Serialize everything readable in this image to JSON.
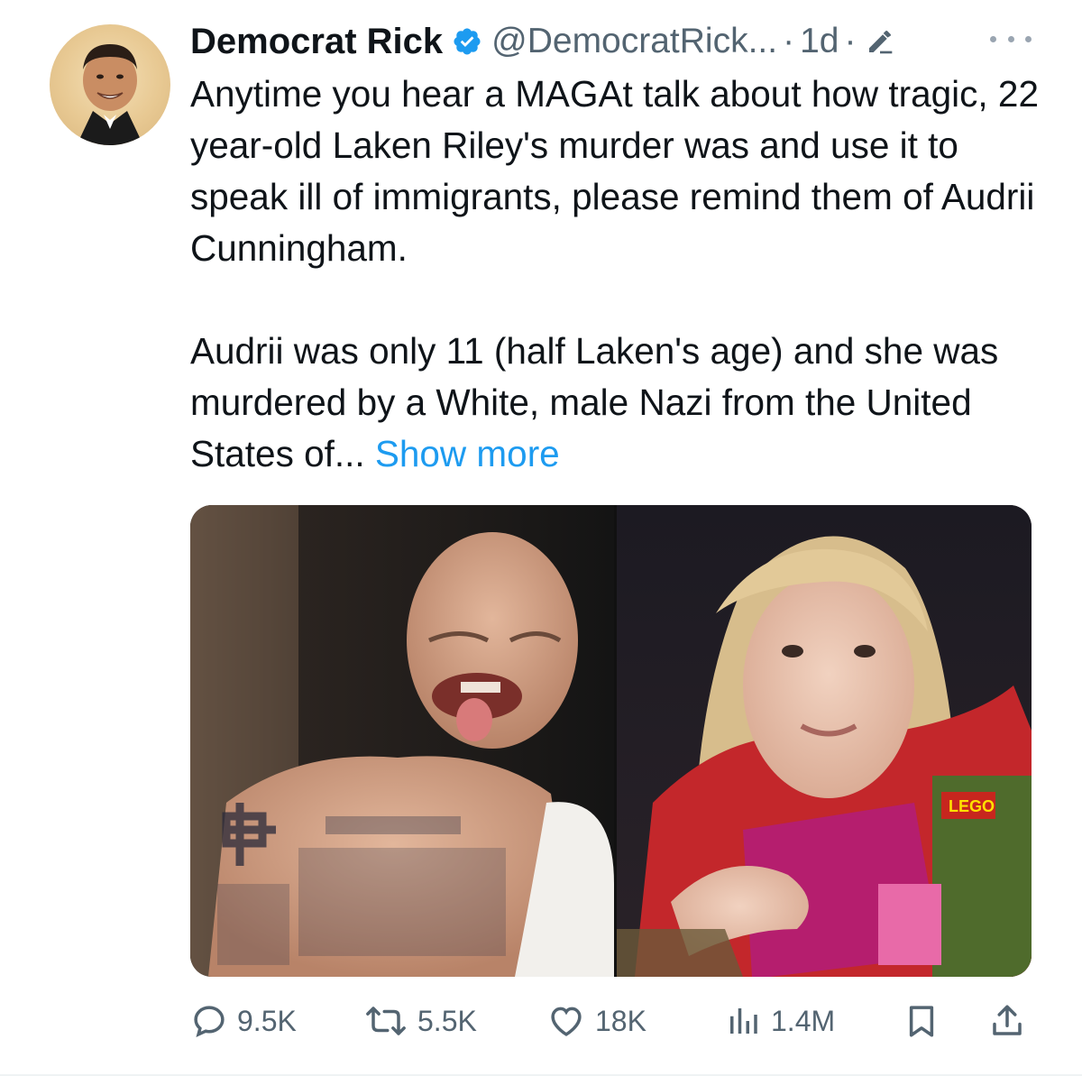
{
  "post": {
    "author_name": "Democrat Rick",
    "author_handle": "@DemocratRick...",
    "separator": "·",
    "age": "1d",
    "paragraph_1": "Anytime you hear a MAGAt talk about how tragic, 22 year-old Laken Riley's murder was and use it to speak ill of immigrants, please remind them of Audrii Cunningham.",
    "paragraph_2": "Audrii was only 11 (half Laken's age) and she was murdered by a White, male Nazi from the United States of...",
    "show_more": "Show more",
    "media_badge_text": "LEGO"
  },
  "actions": {
    "replies": "9.5K",
    "reposts": "5.5K",
    "likes": "18K",
    "views": "1.4M"
  },
  "icons": {
    "verified": "verified-badge-icon",
    "edited": "edit-pencil-icon",
    "more": "more-options-icon",
    "reply": "reply-icon",
    "repost": "repost-icon",
    "like": "heart-icon",
    "views": "analytics-icon",
    "bookmark": "bookmark-icon",
    "share": "share-icon"
  },
  "colors": {
    "text": "#0f1419",
    "secondary": "#536471",
    "link": "#1d9bf0",
    "verified": "#1d9bf0"
  }
}
